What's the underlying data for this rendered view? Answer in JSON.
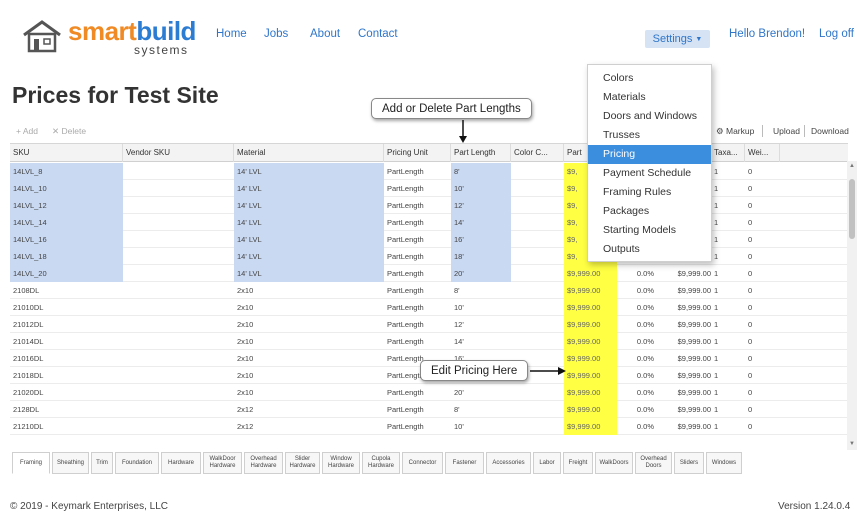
{
  "brand": {
    "part1": "smart",
    "part2": "build",
    "tagline": "systems"
  },
  "nav": {
    "home": "Home",
    "jobs": "Jobs",
    "about": "About",
    "contact": "Contact"
  },
  "settings_label": "Settings",
  "user_greeting": "Hello Brendon!",
  "logoff_label": "Log off",
  "page_title": "Prices for Test Site",
  "callouts": {
    "part_lengths": "Add or Delete Part Lengths",
    "edit_pricing": "Edit Pricing Here"
  },
  "toolbar": {
    "add": "Add",
    "delete": "Delete",
    "markup": "Markup",
    "upload": "Upload",
    "download": "Download"
  },
  "settings_menu": [
    "Colors",
    "Materials",
    "Doors and Windows",
    "Trusses",
    "Pricing",
    "Payment Schedule",
    "Framing Rules",
    "Packages",
    "Starting Models",
    "Outputs"
  ],
  "active_menu_item": "Pricing",
  "columns": [
    "SKU",
    "Vendor SKU",
    "Material",
    "Pricing Unit",
    "Part Length",
    "Color C...",
    "Part",
    "",
    "",
    "Taxa...",
    "Wei..."
  ],
  "rows": [
    {
      "sku": "14LVL_8",
      "vendor": "",
      "material": "14' LVL",
      "unit": "PartLength",
      "length": "8'",
      "color": "",
      "price": "$9,",
      "pct": "",
      "cost": "",
      "tax": "1",
      "weight": "0"
    },
    {
      "sku": "14LVL_10",
      "vendor": "",
      "material": "14' LVL",
      "unit": "PartLength",
      "length": "10'",
      "color": "",
      "price": "$9,",
      "pct": "",
      "cost": "",
      "tax": "1",
      "weight": "0"
    },
    {
      "sku": "14LVL_12",
      "vendor": "",
      "material": "14' LVL",
      "unit": "PartLength",
      "length": "12'",
      "color": "",
      "price": "$9,",
      "pct": "",
      "cost": "",
      "tax": "1",
      "weight": "0"
    },
    {
      "sku": "14LVL_14",
      "vendor": "",
      "material": "14' LVL",
      "unit": "PartLength",
      "length": "14'",
      "color": "",
      "price": "$9,",
      "pct": "",
      "cost": "",
      "tax": "1",
      "weight": "0"
    },
    {
      "sku": "14LVL_16",
      "vendor": "",
      "material": "14' LVL",
      "unit": "PartLength",
      "length": "16'",
      "color": "",
      "price": "$9,",
      "pct": "",
      "cost": "",
      "tax": "1",
      "weight": "0"
    },
    {
      "sku": "14LVL_18",
      "vendor": "",
      "material": "14' LVL",
      "unit": "PartLength",
      "length": "18'",
      "color": "",
      "price": "$9,",
      "pct": "",
      "cost": "",
      "tax": "1",
      "weight": "0"
    },
    {
      "sku": "14LVL_20",
      "vendor": "",
      "material": "14' LVL",
      "unit": "PartLength",
      "length": "20'",
      "color": "",
      "price": "$9,999.00",
      "pct": "0.0%",
      "cost": "$9,999.00",
      "tax": "1",
      "weight": "0"
    },
    {
      "sku": "2108DL",
      "vendor": "",
      "material": "2x10",
      "unit": "PartLength",
      "length": "8'",
      "color": "",
      "price": "$9,999.00",
      "pct": "0.0%",
      "cost": "$9,999.00",
      "tax": "1",
      "weight": "0"
    },
    {
      "sku": "21010DL",
      "vendor": "",
      "material": "2x10",
      "unit": "PartLength",
      "length": "10'",
      "color": "",
      "price": "$9,999.00",
      "pct": "0.0%",
      "cost": "$9,999.00",
      "tax": "1",
      "weight": "0"
    },
    {
      "sku": "21012DL",
      "vendor": "",
      "material": "2x10",
      "unit": "PartLength",
      "length": "12'",
      "color": "",
      "price": "$9,999.00",
      "pct": "0.0%",
      "cost": "$9,999.00",
      "tax": "1",
      "weight": "0"
    },
    {
      "sku": "21014DL",
      "vendor": "",
      "material": "2x10",
      "unit": "PartLength",
      "length": "14'",
      "color": "",
      "price": "$9,999.00",
      "pct": "0.0%",
      "cost": "$9,999.00",
      "tax": "1",
      "weight": "0"
    },
    {
      "sku": "21016DL",
      "vendor": "",
      "material": "2x10",
      "unit": "PartLength",
      "length": "16'",
      "color": "",
      "price": "$9,999.00",
      "pct": "0.0%",
      "cost": "$9,999.00",
      "tax": "1",
      "weight": "0"
    },
    {
      "sku": "21018DL",
      "vendor": "",
      "material": "2x10",
      "unit": "PartLength",
      "length": "18'",
      "color": "",
      "price": "$9,999.00",
      "pct": "0.0%",
      "cost": "$9,999.00",
      "tax": "1",
      "weight": "0"
    },
    {
      "sku": "21020DL",
      "vendor": "",
      "material": "2x10",
      "unit": "PartLength",
      "length": "20'",
      "color": "",
      "price": "$9,999.00",
      "pct": "0.0%",
      "cost": "$9,999.00",
      "tax": "1",
      "weight": "0"
    },
    {
      "sku": "2128DL",
      "vendor": "",
      "material": "2x12",
      "unit": "PartLength",
      "length": "8'",
      "color": "",
      "price": "$9,999.00",
      "pct": "0.0%",
      "cost": "$9,999.00",
      "tax": "1",
      "weight": "0"
    },
    {
      "sku": "21210DL",
      "vendor": "",
      "material": "2x12",
      "unit": "PartLength",
      "length": "10'",
      "color": "",
      "price": "$9,999.00",
      "pct": "0.0%",
      "cost": "$9,999.00",
      "tax": "1",
      "weight": "0"
    }
  ],
  "tabs": [
    "Framing",
    "Sheathing",
    "Trim",
    "Foundation",
    "Hardware",
    "WalkDoor Hardware",
    "Overhead Hardware",
    "Slider Hardware",
    "Window Hardware",
    "Cupola Hardware",
    "Connector",
    "Fastener",
    "Accessories",
    "Labor",
    "Freight",
    "WalkDoors",
    "Overhead Doors",
    "Sliders",
    "Windows"
  ],
  "footer": {
    "copyright": "© 2019 - Keymark Enterprises, LLC",
    "version": "Version 1.24.0.4"
  },
  "colors": {
    "brand_orange": "#f08a24",
    "brand_blue": "#2b7cd3",
    "link": "#2f76c9",
    "menu_active": "#3b8ede",
    "price_highlight": "#ffff44",
    "selection": "#c9d9f2"
  },
  "icons": {
    "logo": "house-icon",
    "settings_caret": "caret-down-icon",
    "add": "plus-icon",
    "delete": "x-icon",
    "markup": "markup-icon"
  }
}
